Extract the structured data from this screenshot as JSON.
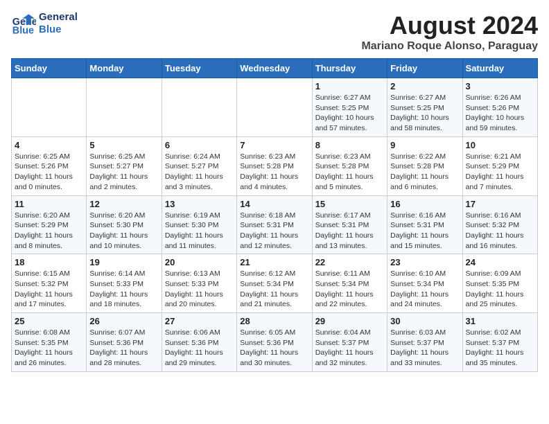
{
  "logo": {
    "line1": "General",
    "line2": "Blue"
  },
  "title": "August 2024",
  "subtitle": "Mariano Roque Alonso, Paraguay",
  "days_of_week": [
    "Sunday",
    "Monday",
    "Tuesday",
    "Wednesday",
    "Thursday",
    "Friday",
    "Saturday"
  ],
  "weeks": [
    [
      {
        "day": "",
        "info": ""
      },
      {
        "day": "",
        "info": ""
      },
      {
        "day": "",
        "info": ""
      },
      {
        "day": "",
        "info": ""
      },
      {
        "day": "1",
        "info": "Sunrise: 6:27 AM\nSunset: 5:25 PM\nDaylight: 10 hours and 57 minutes."
      },
      {
        "day": "2",
        "info": "Sunrise: 6:27 AM\nSunset: 5:25 PM\nDaylight: 10 hours and 58 minutes."
      },
      {
        "day": "3",
        "info": "Sunrise: 6:26 AM\nSunset: 5:26 PM\nDaylight: 10 hours and 59 minutes."
      }
    ],
    [
      {
        "day": "4",
        "info": "Sunrise: 6:25 AM\nSunset: 5:26 PM\nDaylight: 11 hours and 0 minutes."
      },
      {
        "day": "5",
        "info": "Sunrise: 6:25 AM\nSunset: 5:27 PM\nDaylight: 11 hours and 2 minutes."
      },
      {
        "day": "6",
        "info": "Sunrise: 6:24 AM\nSunset: 5:27 PM\nDaylight: 11 hours and 3 minutes."
      },
      {
        "day": "7",
        "info": "Sunrise: 6:23 AM\nSunset: 5:28 PM\nDaylight: 11 hours and 4 minutes."
      },
      {
        "day": "8",
        "info": "Sunrise: 6:23 AM\nSunset: 5:28 PM\nDaylight: 11 hours and 5 minutes."
      },
      {
        "day": "9",
        "info": "Sunrise: 6:22 AM\nSunset: 5:28 PM\nDaylight: 11 hours and 6 minutes."
      },
      {
        "day": "10",
        "info": "Sunrise: 6:21 AM\nSunset: 5:29 PM\nDaylight: 11 hours and 7 minutes."
      }
    ],
    [
      {
        "day": "11",
        "info": "Sunrise: 6:20 AM\nSunset: 5:29 PM\nDaylight: 11 hours and 8 minutes."
      },
      {
        "day": "12",
        "info": "Sunrise: 6:20 AM\nSunset: 5:30 PM\nDaylight: 11 hours and 10 minutes."
      },
      {
        "day": "13",
        "info": "Sunrise: 6:19 AM\nSunset: 5:30 PM\nDaylight: 11 hours and 11 minutes."
      },
      {
        "day": "14",
        "info": "Sunrise: 6:18 AM\nSunset: 5:31 PM\nDaylight: 11 hours and 12 minutes."
      },
      {
        "day": "15",
        "info": "Sunrise: 6:17 AM\nSunset: 5:31 PM\nDaylight: 11 hours and 13 minutes."
      },
      {
        "day": "16",
        "info": "Sunrise: 6:16 AM\nSunset: 5:31 PM\nDaylight: 11 hours and 15 minutes."
      },
      {
        "day": "17",
        "info": "Sunrise: 6:16 AM\nSunset: 5:32 PM\nDaylight: 11 hours and 16 minutes."
      }
    ],
    [
      {
        "day": "18",
        "info": "Sunrise: 6:15 AM\nSunset: 5:32 PM\nDaylight: 11 hours and 17 minutes."
      },
      {
        "day": "19",
        "info": "Sunrise: 6:14 AM\nSunset: 5:33 PM\nDaylight: 11 hours and 18 minutes."
      },
      {
        "day": "20",
        "info": "Sunrise: 6:13 AM\nSunset: 5:33 PM\nDaylight: 11 hours and 20 minutes."
      },
      {
        "day": "21",
        "info": "Sunrise: 6:12 AM\nSunset: 5:34 PM\nDaylight: 11 hours and 21 minutes."
      },
      {
        "day": "22",
        "info": "Sunrise: 6:11 AM\nSunset: 5:34 PM\nDaylight: 11 hours and 22 minutes."
      },
      {
        "day": "23",
        "info": "Sunrise: 6:10 AM\nSunset: 5:34 PM\nDaylight: 11 hours and 24 minutes."
      },
      {
        "day": "24",
        "info": "Sunrise: 6:09 AM\nSunset: 5:35 PM\nDaylight: 11 hours and 25 minutes."
      }
    ],
    [
      {
        "day": "25",
        "info": "Sunrise: 6:08 AM\nSunset: 5:35 PM\nDaylight: 11 hours and 26 minutes."
      },
      {
        "day": "26",
        "info": "Sunrise: 6:07 AM\nSunset: 5:36 PM\nDaylight: 11 hours and 28 minutes."
      },
      {
        "day": "27",
        "info": "Sunrise: 6:06 AM\nSunset: 5:36 PM\nDaylight: 11 hours and 29 minutes."
      },
      {
        "day": "28",
        "info": "Sunrise: 6:05 AM\nSunset: 5:36 PM\nDaylight: 11 hours and 30 minutes."
      },
      {
        "day": "29",
        "info": "Sunrise: 6:04 AM\nSunset: 5:37 PM\nDaylight: 11 hours and 32 minutes."
      },
      {
        "day": "30",
        "info": "Sunrise: 6:03 AM\nSunset: 5:37 PM\nDaylight: 11 hours and 33 minutes."
      },
      {
        "day": "31",
        "info": "Sunrise: 6:02 AM\nSunset: 5:37 PM\nDaylight: 11 hours and 35 minutes."
      }
    ]
  ]
}
